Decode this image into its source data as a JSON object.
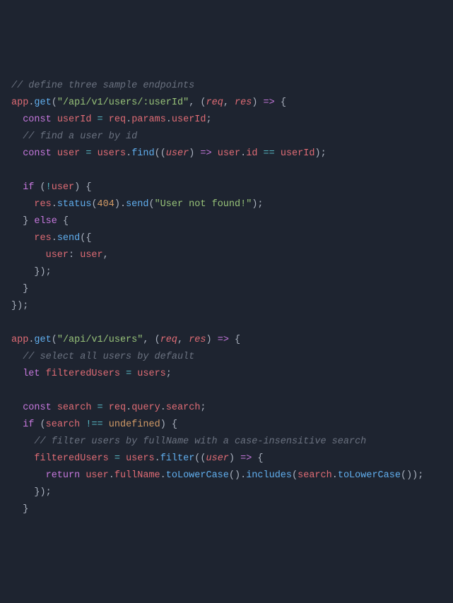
{
  "code": {
    "c1": "// define three sample endpoints",
    "l2_app": "app",
    "l2_get": "get",
    "l2_path": "\"/api/v1/users/:userId\"",
    "l2_req": "req",
    "l2_res": "res",
    "l3_const": "const",
    "l3_userId": "userId",
    "l3_req": "req",
    "l3_params": "params",
    "l3_userIdProp": "userId",
    "c4": "// find a user by id",
    "l5_const": "const",
    "l5_user": "user",
    "l5_users": "users",
    "l5_find": "find",
    "l5_userParam": "user",
    "l5_userRef": "user",
    "l5_id": "id",
    "l5_userIdRef": "userId",
    "l7_if": "if",
    "l7_user": "user",
    "l8_res": "res",
    "l8_status": "status",
    "l8_404": "404",
    "l8_send": "send",
    "l8_msg": "\"User not found!\"",
    "l9_else": "else",
    "l10_res": "res",
    "l10_send": "send",
    "l11_userKey": "user",
    "l11_userVal": "user",
    "l16_app": "app",
    "l16_get": "get",
    "l16_path": "\"/api/v1/users\"",
    "l16_req": "req",
    "l16_res": "res",
    "c17": "// select all users by default",
    "l18_let": "let",
    "l18_filteredUsers": "filteredUsers",
    "l18_users": "users",
    "l20_const": "const",
    "l20_search": "search",
    "l20_req": "req",
    "l20_query": "query",
    "l20_searchProp": "search",
    "l21_if": "if",
    "l21_search": "search",
    "l21_undefined": "undefined",
    "c22": "// filter users by fullName with a case-insensitive search",
    "l23_filteredUsers": "filteredUsers",
    "l23_users": "users",
    "l23_filter": "filter",
    "l23_userParam": "user",
    "l24_return": "return",
    "l24_user": "user",
    "l24_fullName": "fullName",
    "l24_toLowerCase1": "toLowerCase",
    "l24_includes": "includes",
    "l24_search": "search",
    "l24_toLowerCase2": "toLowerCase"
  }
}
